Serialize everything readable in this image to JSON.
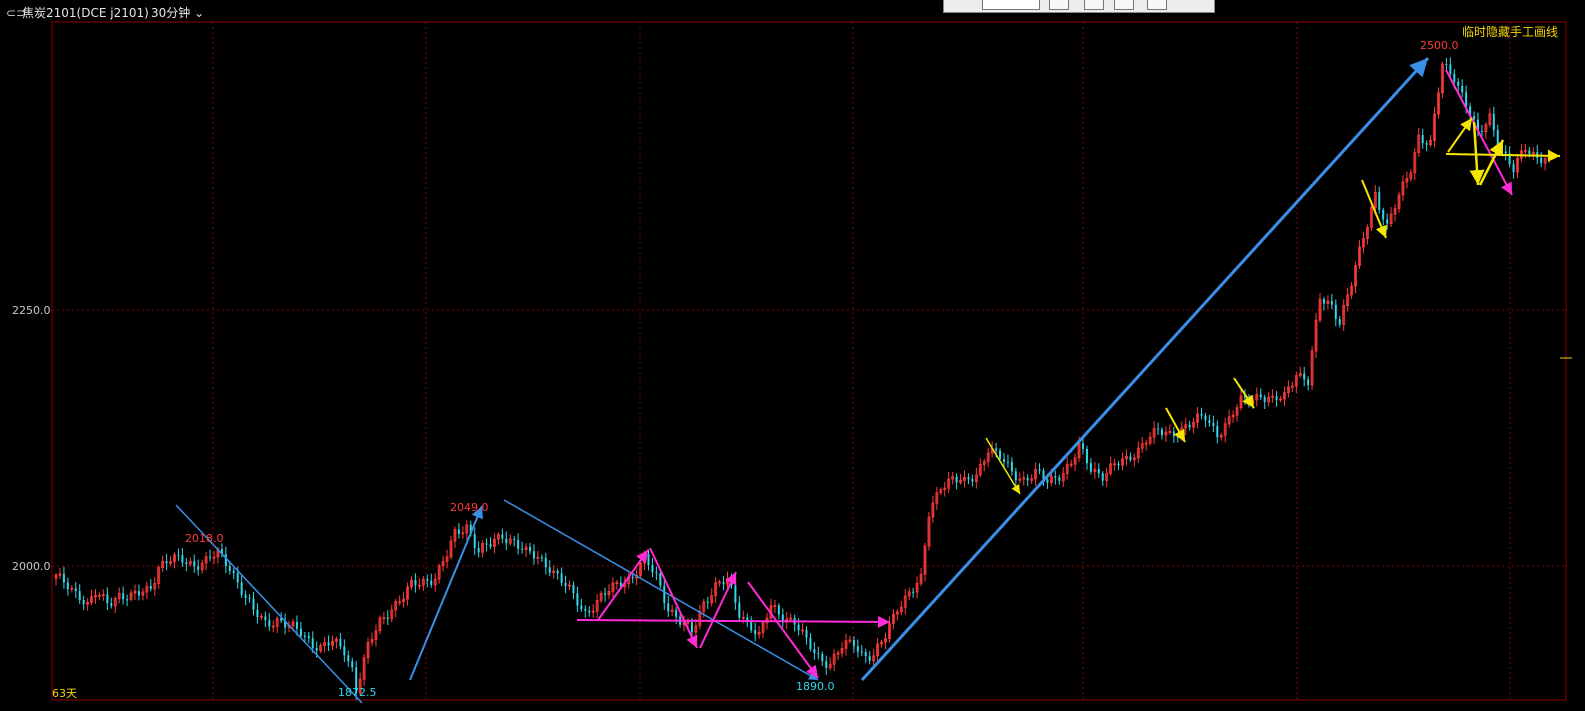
{
  "header": {
    "title_icon": "link-icon",
    "symbol": "焦炭2101(DCE j2101)",
    "period": "30分钟",
    "period_icon": "chevron-down-icon",
    "hide_lines_button": "临时隐藏手工画线"
  },
  "colors": {
    "background": "#000000",
    "grid": "#8b0000",
    "up": "#ff3b3b",
    "down": "#30d8e8",
    "blue_lines": "#3a8fe8",
    "magenta_lines": "#ff2bd6",
    "yellow_lines": "#f5e600"
  },
  "footer": {
    "days_label": "63天"
  },
  "chart_data": {
    "type": "candlestick",
    "title": "",
    "xlabel": "",
    "ylabel": "",
    "y_ticks": [
      {
        "value": 2250.0,
        "label": "2250.0"
      },
      {
        "value": 2000.0,
        "label": "2000.0"
      }
    ],
    "ylim": [
      1862,
      2522
    ],
    "grid": true,
    "annotations": [
      {
        "label": "2018.0",
        "value": 2018.0,
        "kind": "high"
      },
      {
        "label": "1872.5",
        "value": 1872.5,
        "kind": "low"
      },
      {
        "label": "2049.0",
        "value": 2049.0,
        "kind": "high"
      },
      {
        "label": "1890.0",
        "value": 1890.0,
        "kind": "low"
      },
      {
        "label": "2500.0",
        "value": 2500.0,
        "kind": "high"
      }
    ],
    "close_path": [
      [
        0,
        1988
      ],
      [
        3,
        1982
      ],
      [
        6,
        1972
      ],
      [
        8,
        1960
      ],
      [
        10,
        1972
      ],
      [
        13,
        1965
      ],
      [
        16,
        1972
      ],
      [
        19,
        1968
      ],
      [
        22,
        1975
      ],
      [
        24,
        1980
      ],
      [
        26,
        2000
      ],
      [
        29,
        2005
      ],
      [
        32,
        2006
      ],
      [
        35,
        2002
      ],
      [
        38,
        2004
      ],
      [
        41,
        2012
      ],
      [
        44,
        2000
      ],
      [
        46,
        1985
      ],
      [
        48,
        1968
      ],
      [
        50,
        1955
      ],
      [
        53,
        1945
      ],
      [
        56,
        1948
      ],
      [
        59,
        1940
      ],
      [
        62,
        1935
      ],
      [
        65,
        1925
      ],
      [
        67,
        1920
      ],
      [
        70,
        1925
      ],
      [
        73,
        1918
      ],
      [
        75,
        1900
      ],
      [
        76,
        1880
      ],
      [
        79,
        1920
      ],
      [
        82,
        1945
      ],
      [
        85,
        1960
      ],
      [
        88,
        1970
      ],
      [
        90,
        1980
      ],
      [
        93,
        1985
      ],
      [
        96,
        1990
      ],
      [
        99,
        2010
      ],
      [
        101,
        2030
      ],
      [
        104,
        2040
      ],
      [
        107,
        2015
      ],
      [
        110,
        2020
      ],
      [
        113,
        2030
      ],
      [
        116,
        2025
      ],
      [
        119,
        2012
      ],
      [
        122,
        2008
      ],
      [
        125,
        2000
      ],
      [
        128,
        1985
      ],
      [
        131,
        1970
      ],
      [
        134,
        1955
      ],
      [
        137,
        1965
      ],
      [
        140,
        1975
      ],
      [
        143,
        1985
      ],
      [
        146,
        1990
      ],
      [
        149,
        2005
      ],
      [
        152,
        1990
      ],
      [
        155,
        1960
      ],
      [
        158,
        1945
      ],
      [
        161,
        1935
      ],
      [
        164,
        1965
      ],
      [
        167,
        1980
      ],
      [
        170,
        1985
      ],
      [
        173,
        1955
      ],
      [
        176,
        1942
      ],
      [
        178,
        1930
      ],
      [
        181,
        1960
      ],
      [
        184,
        1952
      ],
      [
        187,
        1945
      ],
      [
        190,
        1925
      ],
      [
        193,
        1912
      ],
      [
        196,
        1905
      ],
      [
        199,
        1920
      ],
      [
        202,
        1925
      ],
      [
        204,
        1915
      ],
      [
        207,
        1912
      ],
      [
        210,
        1930
      ],
      [
        213,
        1960
      ],
      [
        216,
        1975
      ],
      [
        219,
        1985
      ],
      [
        221,
        2050
      ],
      [
        224,
        2080
      ],
      [
        227,
        2085
      ],
      [
        230,
        2080
      ],
      [
        233,
        2090
      ],
      [
        236,
        2115
      ],
      [
        239,
        2105
      ],
      [
        242,
        2092
      ],
      [
        245,
        2085
      ],
      [
        248,
        2090
      ],
      [
        251,
        2082
      ],
      [
        254,
        2090
      ],
      [
        257,
        2100
      ],
      [
        259,
        2115
      ],
      [
        262,
        2095
      ],
      [
        265,
        2090
      ],
      [
        268,
        2098
      ],
      [
        271,
        2102
      ],
      [
        274,
        2115
      ],
      [
        276,
        2125
      ],
      [
        279,
        2130
      ],
      [
        282,
        2128
      ],
      [
        285,
        2135
      ],
      [
        288,
        2140
      ],
      [
        291,
        2145
      ],
      [
        294,
        2130
      ],
      [
        297,
        2142
      ],
      [
        300,
        2160
      ],
      [
        303,
        2165
      ],
      [
        305,
        2168
      ],
      [
        308,
        2160
      ],
      [
        311,
        2165
      ],
      [
        314,
        2190
      ],
      [
        317,
        2180
      ],
      [
        320,
        2260
      ],
      [
        323,
        2255
      ],
      [
        325,
        2240
      ],
      [
        328,
        2275
      ],
      [
        331,
        2320
      ],
      [
        334,
        2365
      ],
      [
        337,
        2330
      ],
      [
        340,
        2360
      ],
      [
        343,
        2390
      ],
      [
        345,
        2420
      ],
      [
        348,
        2410
      ],
      [
        351,
        2490
      ],
      [
        354,
        2480
      ],
      [
        357,
        2450
      ],
      [
        360,
        2420
      ],
      [
        363,
        2440
      ],
      [
        366,
        2405
      ],
      [
        369,
        2385
      ],
      [
        372,
        2410
      ],
      [
        375,
        2400
      ],
      [
        378,
        2395
      ]
    ]
  }
}
